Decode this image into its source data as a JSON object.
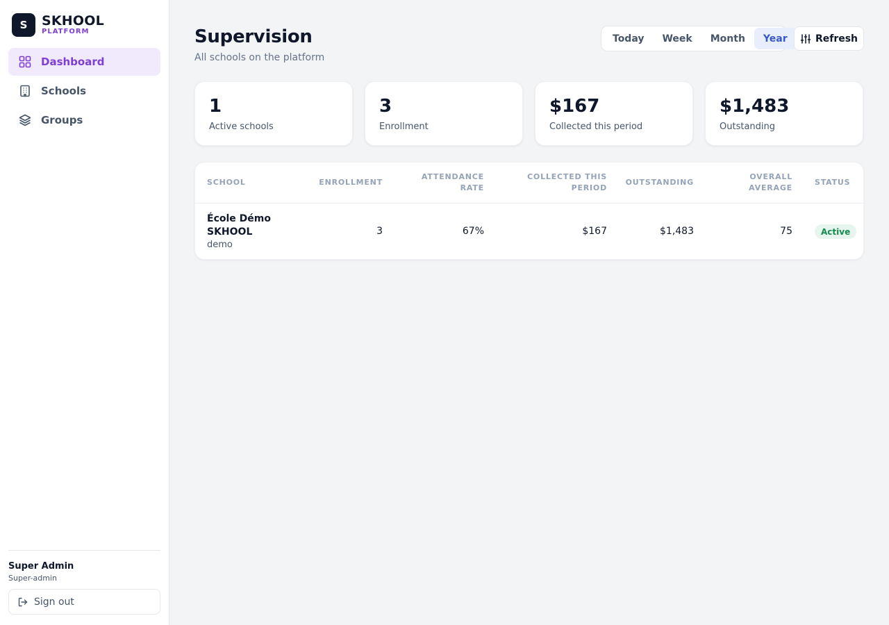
{
  "brand": {
    "logo_letter": "S",
    "name": "SKHOOL",
    "sub": "PLATFORM"
  },
  "sidebar": {
    "items": [
      {
        "label": "Dashboard",
        "icon": "grid-icon",
        "active": true
      },
      {
        "label": "Schools",
        "icon": "building-icon",
        "active": false
      },
      {
        "label": "Groups",
        "icon": "layers-icon",
        "active": false
      }
    ],
    "user": {
      "name": "Super Admin",
      "role": "Super-admin"
    },
    "signout_label": "Sign out"
  },
  "header": {
    "title": "Supervision",
    "subtitle": "All schools on the platform",
    "periods": [
      "Today",
      "Week",
      "Month",
      "Year"
    ],
    "active_period": "Year",
    "refresh_label": "Refresh"
  },
  "stats": [
    {
      "value": "1",
      "label": "Active schools"
    },
    {
      "value": "3",
      "label": "Enrollment"
    },
    {
      "value": "$167",
      "label": "Collected this period"
    },
    {
      "value": "$1,483",
      "label": "Outstanding"
    }
  ],
  "table": {
    "columns": {
      "school": "School",
      "enrollment": "Enrollment",
      "attendance": "Attendance rate",
      "collected": "Collected this period",
      "outstanding": "Outstanding",
      "average": "Overall average",
      "status": "Status"
    },
    "rows": [
      {
        "school_name_line1": "École Démo",
        "school_name_line2": "SKHOOL",
        "slug": "demo",
        "enrollment": "3",
        "attendance": "67%",
        "collected": "$167",
        "outstanding": "$1,483",
        "average": "75",
        "status": "Active"
      }
    ]
  },
  "colors": {
    "accent": "#7e3fd2",
    "active_period_bg": "#e8eefb",
    "active_period_text": "#3659c7",
    "status_active_bg": "#e6f6ee",
    "status_active_text": "#168a4f"
  }
}
